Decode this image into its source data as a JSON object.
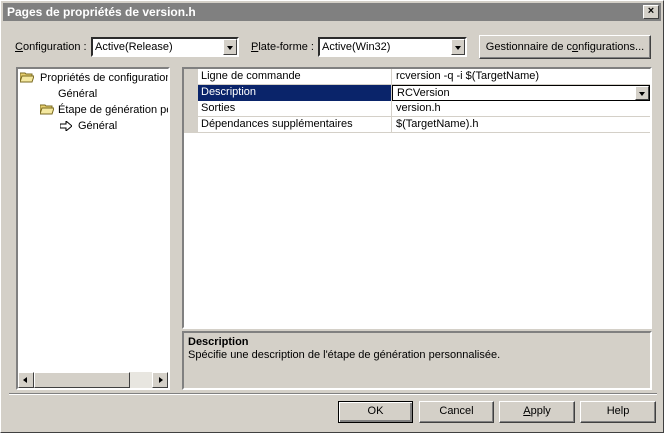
{
  "window": {
    "title": "Pages de propriétés de version.h",
    "close_label": "×"
  },
  "config": {
    "label_pre": "",
    "label_u": "C",
    "label_post": "onfiguration :",
    "value": "Active(Release)"
  },
  "platform": {
    "label_pre": "",
    "label_u": "P",
    "label_post": "late-forme :",
    "value": "Active(Win32)"
  },
  "config_manager_pre": "Gestionnaire de c",
  "config_manager_u": "o",
  "config_manager_post": "nfigurations...",
  "tree": {
    "items": [
      {
        "label": "Propriétés de configuration",
        "icon": "folder-open-icon"
      },
      {
        "label": "Général"
      },
      {
        "label": "Étape de génération pe",
        "icon": "folder-open-icon"
      },
      {
        "label": "Général",
        "icon": "arrow-right-icon"
      }
    ]
  },
  "grid": {
    "rows": [
      {
        "name": "Ligne de commande",
        "value": "rcversion -q -i $(TargetName)"
      },
      {
        "name": "Description",
        "value": "RCVersion",
        "selected": true
      },
      {
        "name": "Sorties",
        "value": "version.h"
      },
      {
        "name": "Dépendances supplémentaires",
        "value": "$(TargetName).h"
      }
    ]
  },
  "description": {
    "title": "Description",
    "text": "Spécifie une description de l'étape de génération personnalisée."
  },
  "buttons": {
    "ok": "OK",
    "cancel": "Cancel",
    "apply_u": "A",
    "apply_post": "pply",
    "help": "Help"
  }
}
